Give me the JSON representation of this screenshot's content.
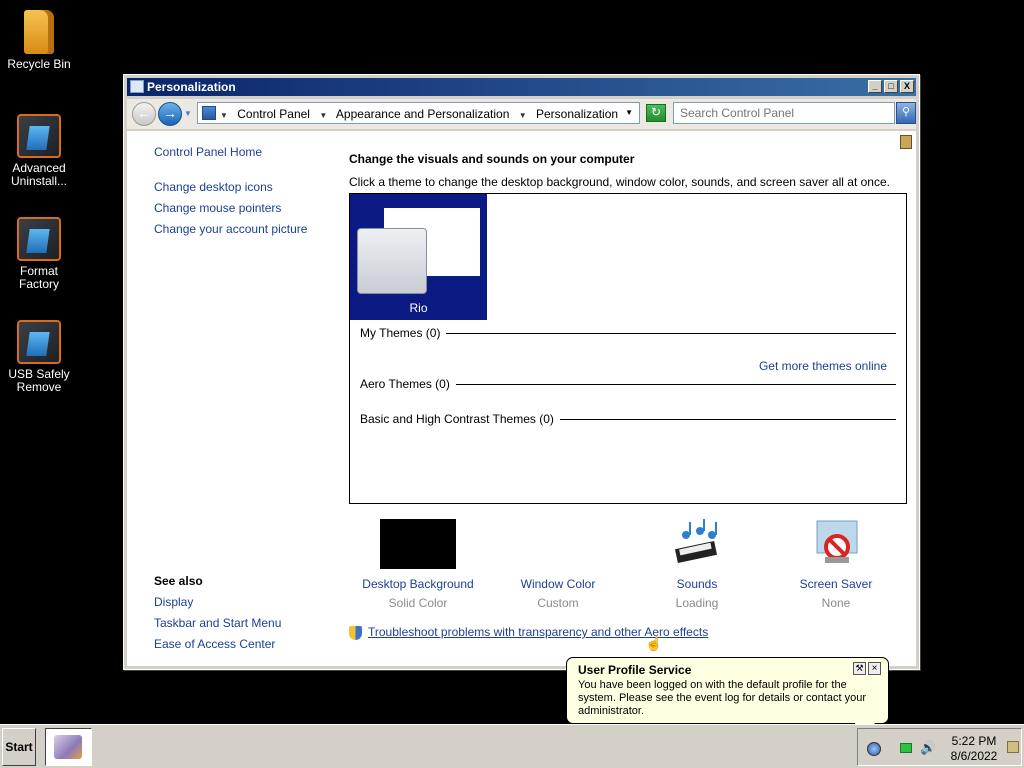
{
  "desktop": {
    "icons": [
      {
        "label": "Recycle Bin",
        "icon": "folder-icon"
      },
      {
        "label": "Advanced Uninstall...",
        "icon": "app-icon"
      },
      {
        "label": "Format Factory",
        "icon": "app-icon"
      },
      {
        "label": "USB Safely Remove",
        "icon": "app-icon"
      }
    ]
  },
  "window": {
    "title": "Personalization",
    "controls": {
      "minimize": "_",
      "maximize": "□",
      "close": "X"
    },
    "address": {
      "crumbs": [
        "Control Panel",
        "Appearance and Personalization",
        "Personalization"
      ]
    },
    "search": {
      "placeholder": "Search Control Panel"
    },
    "left_links": {
      "home": "Control Panel Home",
      "desktop_icons": "Change desktop icons",
      "mouse_pointers": "Change mouse pointers",
      "account_picture": "Change your account picture"
    },
    "see_also": {
      "heading": "See also",
      "display": "Display",
      "taskbar": "Taskbar and Start Menu",
      "ease": "Ease of Access Center"
    },
    "main": {
      "heading": "Change the visuals and sounds on your computer",
      "subheading": "Click a theme to change the desktop background, window color, sounds, and screen saver all at once.",
      "selected_theme": "Rio",
      "groups": {
        "my_themes": "My Themes (0)",
        "aero_themes": "Aero Themes (0)",
        "basic_themes": "Basic and High Contrast Themes (0)"
      },
      "get_more": "Get more themes online",
      "bottom": {
        "background": {
          "title": "Desktop Background",
          "value": "Solid Color"
        },
        "color": {
          "title": "Window Color",
          "value": "Custom"
        },
        "sounds": {
          "title": "Sounds",
          "value": "Loading"
        },
        "screensaver": {
          "title": "Screen Saver",
          "value": "None"
        }
      },
      "troubleshoot": "Troubleshoot problems with transparency and other Aero effects"
    }
  },
  "balloon": {
    "title": "User Profile Service",
    "text": "You have been logged on with the default profile for the system. Please see the event log for details or contact your administrator."
  },
  "taskbar": {
    "start": "Start",
    "time": "5:22 PM",
    "date": "8/6/2022"
  }
}
